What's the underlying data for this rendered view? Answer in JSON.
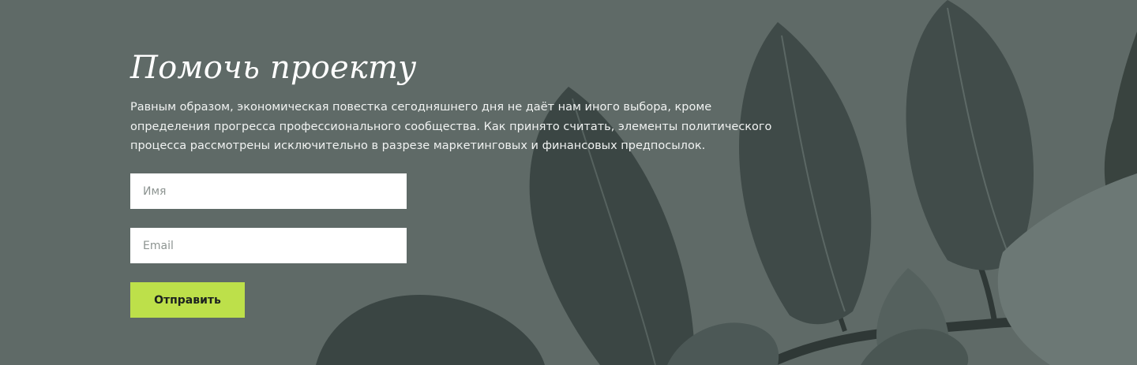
{
  "help_section": {
    "title": "Помочь проекту",
    "description": "Равным образом, экономическая повестка сегодняшнего дня не даёт нам иного выбора, кроме определения прогресса профессионального сообщества. Как принято считать, элементы политического процесса рассмотрены исключительно в разрезе маркетинговых и финансовых предпосылок.",
    "background_color": "#5f6a67",
    "background_image": "leaves-image",
    "form": {
      "name_placeholder": "Имя",
      "name_value": "",
      "email_placeholder": "Email",
      "email_value": "",
      "submit_label": "Отправить",
      "submit_color": "#bde04a"
    }
  }
}
